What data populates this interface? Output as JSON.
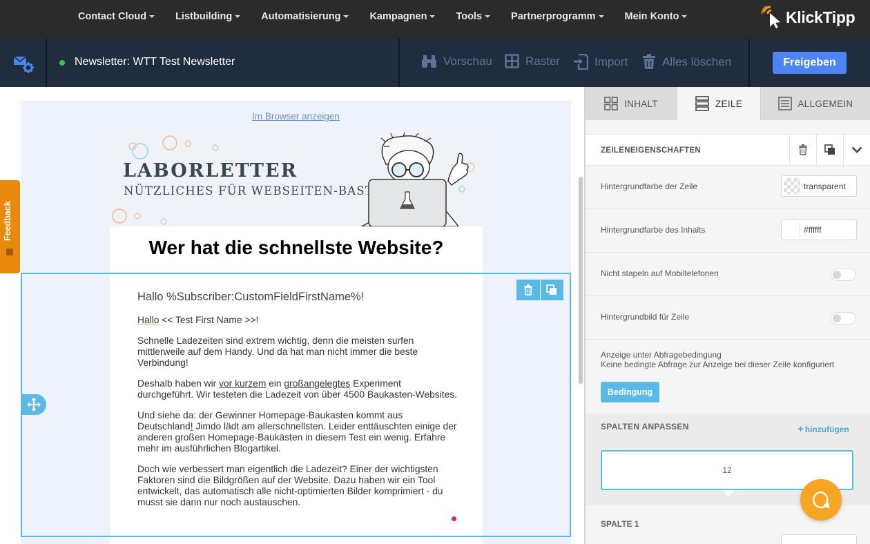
{
  "topnav": {
    "menu": [
      {
        "label": "Contact Cloud"
      },
      {
        "label": "Listbuilding"
      },
      {
        "label": "Automatisierung"
      },
      {
        "label": "Kampagnen"
      },
      {
        "label": "Tools"
      },
      {
        "label": "Partnerprogramm"
      },
      {
        "label": "Mein Konto"
      }
    ],
    "logo_text": "KlickTipp"
  },
  "toolbar": {
    "newsletter_title": "Newsletter: WTT Test Newsletter",
    "preview": "Vorschau",
    "grid": "Raster",
    "import": "Import",
    "delete_all": "Alles löschen",
    "publish": "Freigeben"
  },
  "email": {
    "browser_link": "Im Browser anzeigen",
    "header_title": "LABORLETTER",
    "header_subtitle": "NÜTZLICHES FÜR WEBSEITEN-BASTLER",
    "headline": "Wer hat die schnellste Website?",
    "greeting": "Hallo %Subscriber:CustomFieldFirstName%!",
    "p1": {
      "a": "Hallo",
      "b": " << Test First Name >>!"
    },
    "p2": "Schnelle Ladezeiten sind extrem wichtig, denn die meisten surfen mittlerweile auf dem Handy. Und da hat man nicht immer die beste Verbindung!",
    "p3": {
      "a": "Deshalb haben wir ",
      "b": "vor kurzem",
      "c": " ein ",
      "d": "großangelegtes",
      "e": " Experiment durchgeführt. Wir testeten die Ladezeit von über 4500 Baukasten-Websites."
    },
    "p4": {
      "a": "Und siehe da: der Gewinner Homepage-Baukasten kommt aus Deutschland",
      "b": "!",
      "c": " Jimdo lädt am allerschnellsten. Leider enttäuschten einige der anderen großen Homepage-Baukästen in diesem Test ein wenig. Erfahre mehr im ausführlichen Blogartikel."
    },
    "p5": "Doch wie verbessert man eigentlich die Ladezeit? Einer der wichtigsten Faktoren sind die Bildgrößen auf der Website. Dazu haben wir ein Tool entwickelt, das automatisch alle nicht-optimierten Bilder komprimiert - du musst sie dann nur noch austauschen."
  },
  "feedback_label": "Feedback",
  "panel": {
    "tabs": [
      {
        "label": "INHALT",
        "icon": "grid-icon"
      },
      {
        "label": "ZEILE",
        "icon": "rows-icon"
      },
      {
        "label": "ALLGEMEIN",
        "icon": "document-icon"
      }
    ],
    "active_tab": "ZEILE",
    "section_title": "ZEILENEIGENSCHAFTEN",
    "row_bg_label": "Hintergrundfarbe der Zeile",
    "row_bg_value": "transparent",
    "content_bg_label": "Hintergrundfarbe des Inhalts",
    "content_bg_value": "#ffffff",
    "no_stack_label": "Nicht stapeln auf Mobiltelefonen",
    "bg_image_label": "Hintergrundbild für Zeile",
    "condition_title": "Anzeige unter Abfragebedingung",
    "condition_desc": "Keine bedingte Abfrage zur Anzeige bei dieser Zeile konfiguriert",
    "condition_button": "Bedingung",
    "columns_title": "SPALTEN ANPASSEN",
    "columns_add": "hinzufügen",
    "column_width": "12",
    "column1_title": "SPALTE 1"
  },
  "colors": {
    "accent": "#5bb9e6",
    "publish": "#4d84f4",
    "feedback": "#e9890e",
    "chat": "#f6a623"
  }
}
